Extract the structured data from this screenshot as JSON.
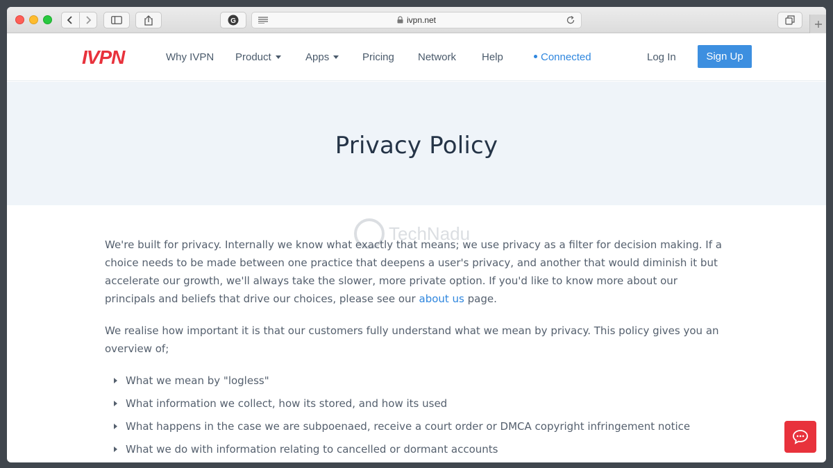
{
  "browser": {
    "url": "ivpn.net"
  },
  "site": {
    "logo": "IVPN",
    "nav": {
      "why": "Why IVPN",
      "product": "Product",
      "apps": "Apps",
      "pricing": "Pricing",
      "network": "Network",
      "help": "Help",
      "connected": "Connected",
      "login": "Log In",
      "signup": "Sign Up"
    },
    "colors": {
      "brand": "#e8323c",
      "accent": "#3d8fe0",
      "hero_bg": "#eff4f9"
    }
  },
  "hero": {
    "title": "Privacy Policy"
  },
  "content": {
    "p1_start": "We're built for privacy. Internally we know what exactly that means; we use privacy as a filter for decision making. If a choice needs to be made between one practice that deepens a user's privacy, and another that would diminish it but accelerate our growth, we'll always take the slower, more private option. If you'd like to know more about our principals and beliefs that drive our choices, please see our ",
    "p1_link": "about us",
    "p1_end": " page.",
    "p2": "We realise how important it is that our customers fully understand what we mean by privacy. This policy gives you an overview of;",
    "bullets": [
      "What we mean by \"logless\"",
      "What information we collect, how its stored, and how its used",
      "What happens in the case we are subpoenaed, receive a court order or DMCA copyright infringement notice",
      "What we do with information relating to cancelled or dormant accounts"
    ]
  },
  "watermark": {
    "text": "TechNadu"
  },
  "icons": {
    "chat": "chat-icon"
  }
}
